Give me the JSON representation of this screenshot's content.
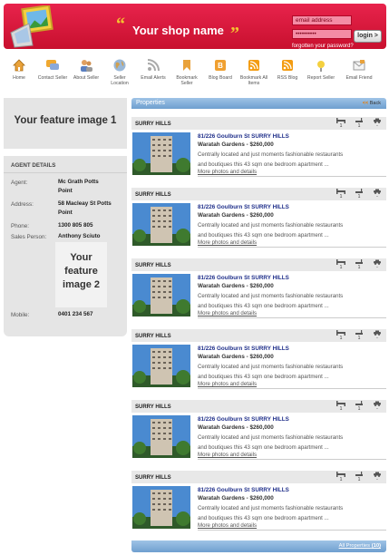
{
  "header": {
    "shop_name": "Your shop name",
    "quote_open": "“",
    "quote_close": "”",
    "email_placeholder": "email address",
    "password_value": "••••••••••",
    "login_label": "login >",
    "forgot_label": "forgotten your password?"
  },
  "nav": [
    {
      "label": "Home",
      "icon": "home-icon"
    },
    {
      "label": "Contact Seller",
      "icon": "chat-icon"
    },
    {
      "label": "About Seller",
      "icon": "people-icon"
    },
    {
      "label": "Seller Location",
      "icon": "globe-icon"
    },
    {
      "label": "Email Alerts",
      "icon": "rss-icon"
    },
    {
      "label": "Bookmark Seller",
      "icon": "bookmark-icon"
    },
    {
      "label": "Blog Board",
      "icon": "blog-icon"
    },
    {
      "label": "Bookmark All Items",
      "icon": "rss-feed-icon"
    },
    {
      "label": "RSS Blog",
      "icon": "rss-blog-icon"
    },
    {
      "label": "Report Seller",
      "icon": "report-icon"
    },
    {
      "label": "Email Friend",
      "icon": "email-icon"
    }
  ],
  "feature1": "Your feature image 1",
  "agent": {
    "heading": "AGENT DETAILS",
    "agent_label": "Agent:",
    "agent_value": "Mc Grath Potts Point",
    "address_label": "Address:",
    "address_value": "58 Macleay St Potts Point",
    "phone_label": "Phone:",
    "phone_value": "1300 805 805",
    "salesperson_label": "Sales Person:",
    "salesperson_value": "Anthony Sciuto",
    "feature2": "Your feature image 2",
    "mobile_label": "Mobile:",
    "mobile_value": "0401 234 567"
  },
  "properties": {
    "title": "Properties",
    "back_arrow": "<<",
    "back_label": "Back",
    "all_label": "All Properties",
    "count": "(10)",
    "items": [
      {
        "suburb": "SURRY HILLS",
        "title": "81/226 Goulburn St SURRY HILLS",
        "sub": "Waratah Gardens - $260,000",
        "desc1": "Centrally located and just moments fashionable restaurants",
        "desc2": "and boutiques this 43 sqm one bedroom apartment ...",
        "more": "More photos and details",
        "beds": "1",
        "baths": "1",
        "cars": "-"
      },
      {
        "suburb": "SURRY HILLS",
        "title": "81/226 Goulburn St SURRY HILLS",
        "sub": "Waratah Gardens - $260,000",
        "desc1": "Centrally located and just moments fashionable restaurants",
        "desc2": "and boutiques this 43 sqm one bedroom apartment ...",
        "more": "More photos and details",
        "beds": "1",
        "baths": "1",
        "cars": "-"
      },
      {
        "suburb": "SURRY HILLS",
        "title": "81/226 Goulburn St SURRY HILLS",
        "sub": "Waratah Gardens - $260,000",
        "desc1": "Centrally located and just moments fashionable restaurants",
        "desc2": "and boutiques this 43 sqm one bedroom apartment ...",
        "more": "More photos and details",
        "beds": "1",
        "baths": "1",
        "cars": "-"
      },
      {
        "suburb": "SURRY HILLS",
        "title": "81/226 Goulburn St SURRY HILLS",
        "sub": "Waratah Gardens - $260,000",
        "desc1": "Centrally located and just moments fashionable restaurants",
        "desc2": "and boutiques this 43 sqm one bedroom apartment ...",
        "more": "More photos and details",
        "beds": "1",
        "baths": "1",
        "cars": "-"
      },
      {
        "suburb": "SURRY HILLS",
        "title": "81/226 Goulburn St SURRY HILLS",
        "sub": "Waratah Gardens - $260,000",
        "desc1": "Centrally located and just moments fashionable restaurants",
        "desc2": "and boutiques this 43 sqm one bedroom apartment ...",
        "more": "More photos and details",
        "beds": "1",
        "baths": "1",
        "cars": "-"
      },
      {
        "suburb": "SURRY HILLS",
        "title": "81/226 Goulburn St SURRY HILLS",
        "sub": "Waratah Gardens - $260,000",
        "desc1": "Centrally located and just moments fashionable restaurants",
        "desc2": "and boutiques this 43 sqm one bedroom apartment ...",
        "more": "More photos and details",
        "beds": "1",
        "baths": "1",
        "cars": "-"
      }
    ]
  },
  "colors": {
    "header_red": "#d0143a",
    "bar_blue": "#8fb5dd",
    "title_blue": "#1f2f8a",
    "panel_gray": "#e5e5e5"
  }
}
